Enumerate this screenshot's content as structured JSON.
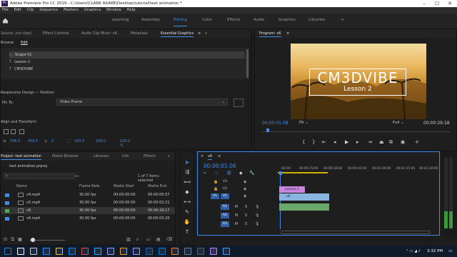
{
  "titlebar": {
    "app_logo": "Pr",
    "title": "Adobe Premiere Pro CC 2019 - C:\\Users\\CLARK ASARE\\Desktop\\tutorial\\text animation *",
    "min_icon": "minimize-icon",
    "max_icon": "maximize-icon",
    "close_icon": "close-icon"
  },
  "menubar": [
    "File",
    "Edit",
    "Clip",
    "Sequence",
    "Markers",
    "Graphics",
    "Window",
    "Help"
  ],
  "workspaces": {
    "tabs": [
      "Learning",
      "Assembly",
      "Editing",
      "Color",
      "Effects",
      "Audio",
      "Graphics",
      "Libraries"
    ],
    "active": "Editing",
    "more": "»"
  },
  "source_panel": {
    "tabs": [
      "Source: (no clips)",
      "Effect Controls",
      "Audio Clip Mixer: v6",
      "Metadata",
      "Essential Graphics"
    ],
    "active_tab": "Essential Graphics",
    "subtabs": [
      "Browse",
      "Edit"
    ],
    "layers": [
      "Shape 01",
      "Lesson 2",
      "CM3DVIBE"
    ],
    "responsive_label": "Responsive Design — Position",
    "pin_to_label": "Pin To:",
    "pin_to_value": "Video Frame",
    "align_label": "Align and Transform",
    "pos_x": "796.0",
    "pos_y": "456.0",
    "val3": "0",
    "scale_w": "160.0",
    "scale_h": "160.0",
    "opacity": "100.0 %"
  },
  "program_monitor": {
    "tab": "Program: v6",
    "title_text": "CM3DVIBE",
    "subtitle_text": "Lesson 2",
    "timecode": "00:00:01:08",
    "fit": "Fit",
    "quality": "Full",
    "duration": "00:00:29:18"
  },
  "project_panel": {
    "tabs": [
      "Project: text animation",
      "Media Browser",
      "Libraries",
      "Info",
      "Effects"
    ],
    "file": "text animation.prproj",
    "items_count": "1 of 7 items selected",
    "columns": [
      "Name",
      "Frame Rate",
      "Media Start",
      "Media End"
    ],
    "rows": [
      {
        "name": "v4.mp4",
        "fps": "30.00 fps",
        "start": "00:00:00:00",
        "end": "00:00:05:07",
        "color": "#3d8df0"
      },
      {
        "name": "v5.mp4",
        "fps": "30.00 fps",
        "start": "00:00:00:00",
        "end": "00:00:02:21",
        "color": "#3d8df0"
      },
      {
        "name": "v6",
        "fps": "30.00 fps",
        "start": "00:00:00:00",
        "end": "00:00:29:17",
        "color": "#4caf50"
      },
      {
        "name": "v6.mp4",
        "fps": "30.00 fps",
        "start": "00:00:00:00",
        "end": "00:00:03:20",
        "color": "#3d8df0"
      }
    ]
  },
  "timeline": {
    "tab": "v6",
    "timecode": "00:00:01:06",
    "ruler": [
      ":00:00",
      "00:00:15:00",
      "00:00:30:00",
      "00:00:45:00",
      "00:01:00:00",
      "00:01:15:00",
      "00:01:30:00"
    ],
    "video_tracks": [
      "V3",
      "V2",
      "V1"
    ],
    "audio_tracks": [
      "A1",
      "A2",
      "A3"
    ],
    "clip_label": "Lesson 2",
    "clip_v1": "v6",
    "db_marks": [
      "0",
      "-12",
      "-24",
      "-36",
      "-48",
      "dB"
    ]
  },
  "taskbar": {
    "time": "3:32 PM",
    "icons": [
      "windows-icon",
      "search-icon",
      "task-view-icon",
      "ie-icon",
      "explorer-icon",
      "store-icon",
      "chrome-icon",
      "photoshop-icon",
      "aftereffects-icon",
      "illustrator-icon",
      "premiere-icon",
      "media-encoder-icon",
      "mail-icon",
      "vlc-icon",
      "winamp-icon",
      "app-icon",
      "premiere-active-icon",
      "app2-icon"
    ]
  },
  "colors": {
    "accent": "#3d8df0",
    "clip_pink": "#c986e0",
    "clip_blue": "#8ab4e0",
    "audio_green": "#4caf50"
  }
}
